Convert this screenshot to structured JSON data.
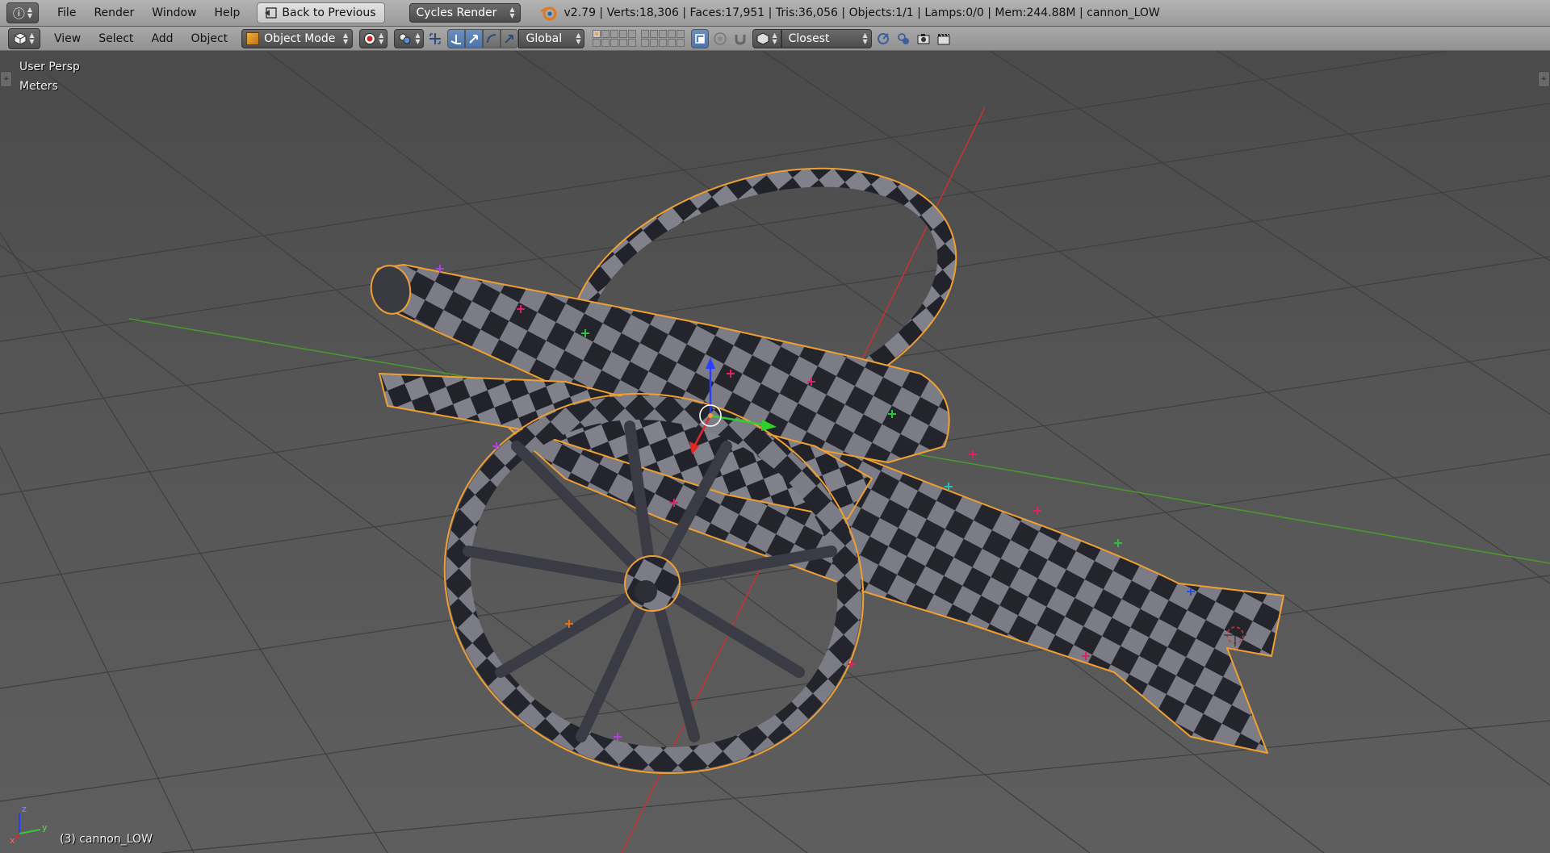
{
  "info_header": {
    "editor_icon": "info-icon",
    "menu": [
      "File",
      "Render",
      "Window",
      "Help"
    ],
    "back_button": "Back to Previous",
    "render_engine": "Cycles Render",
    "stats": "v2.79 | Verts:18,306 | Faces:17,951 | Tris:36,056 | Objects:1/1 | Lamps:0/0 | Mem:244.88M | cannon_LOW"
  },
  "view3d_header": {
    "editor_icon": "3d-view-cube-icon",
    "menu": [
      "View",
      "Select",
      "Add",
      "Object"
    ],
    "mode": "Object Mode",
    "transform_orientation": "Global",
    "snap_target": "Closest",
    "accent": "#5680c2"
  },
  "viewport": {
    "view_name": "User Persp",
    "units": "Meters",
    "active_object": "(3) cannon_LOW",
    "axis_labels": {
      "x": "x",
      "y": "y",
      "z": "z"
    },
    "colors": {
      "x_axis": "#c83232",
      "y_axis": "#4a9a2c",
      "selection_outline": "#f0a030",
      "checker_light": "#7b7c86",
      "checker_dark": "#24252c"
    }
  }
}
